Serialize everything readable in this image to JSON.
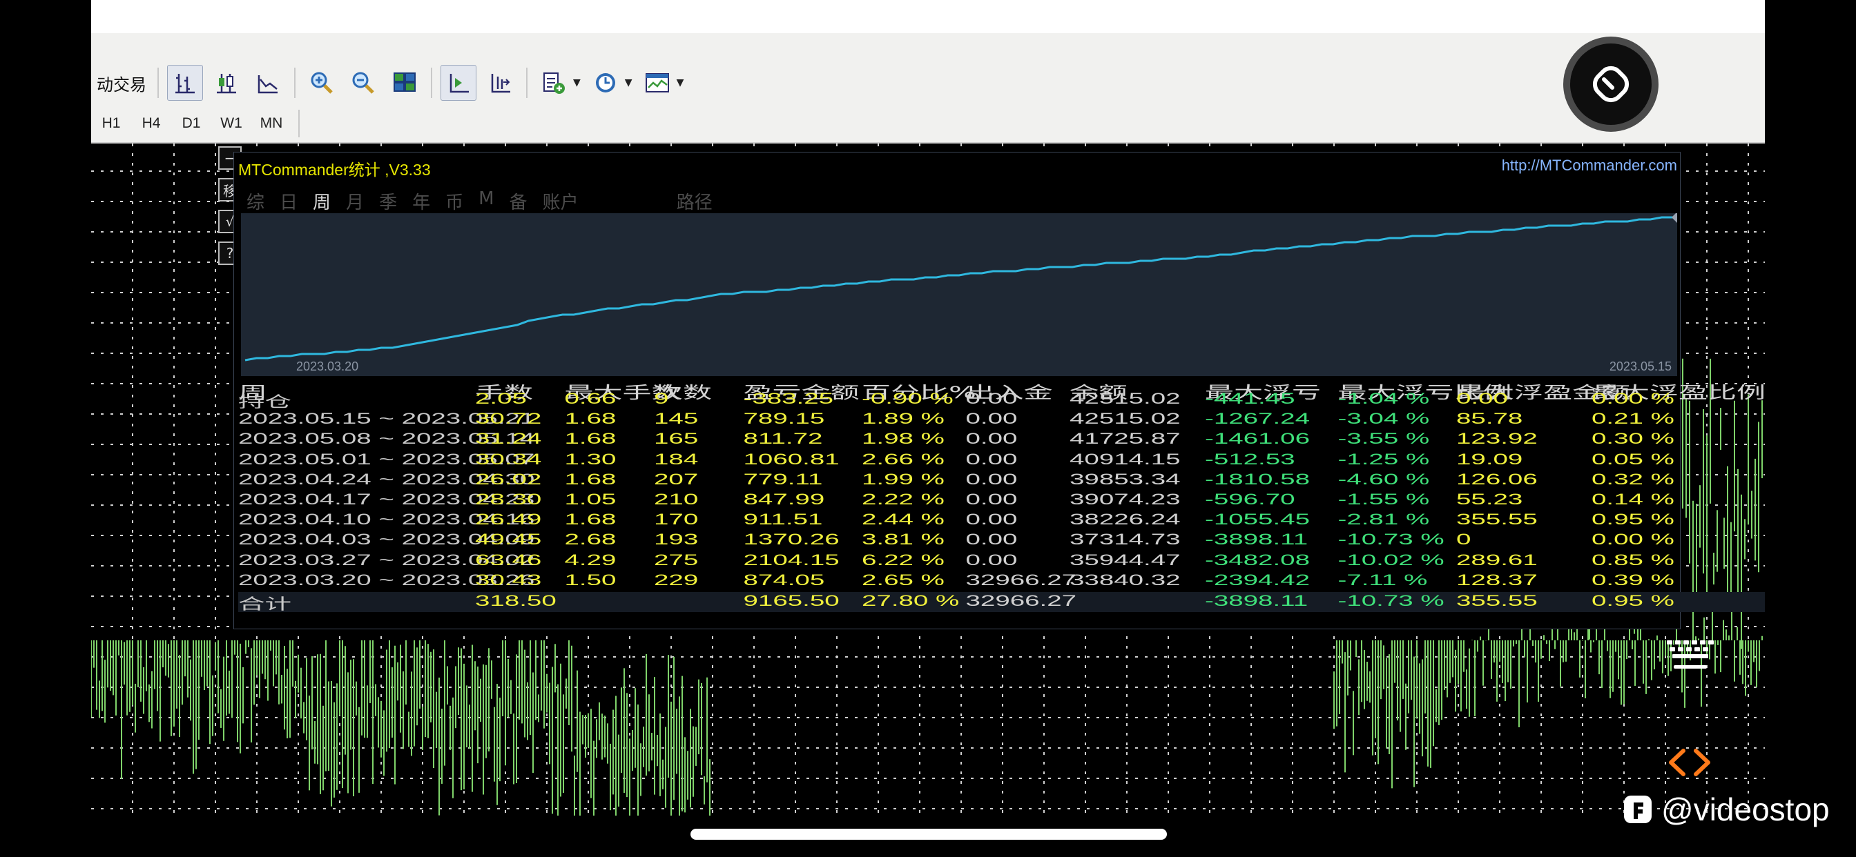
{
  "toolbar": {
    "auto_trade_label": "动交易",
    "timeframes": [
      "H1",
      "H4",
      "D1",
      "W1",
      "MN"
    ]
  },
  "panel": {
    "title": "MTCommander统计 ,V3.33",
    "url": "http://MTCommander.com",
    "side_buttons": [
      "−",
      "移",
      "√",
      "?"
    ],
    "tabs": [
      "综",
      "日",
      "周",
      "月",
      "季",
      "年",
      "币",
      "M",
      "备",
      "账户"
    ],
    "active_tab": "周",
    "path_label": "路径",
    "curve": {
      "start_date_label": "2023.03.20",
      "end_date_label": "2023.05.15",
      "line_color": "#2fb8df"
    },
    "columns": [
      "周",
      "手数",
      "最大手数",
      "次数",
      "盈亏金额",
      "百分比%",
      "出入金",
      "余额",
      "最大浮亏",
      "最大浮亏比例",
      "最大浮盈金额",
      "最大浮盈比例"
    ],
    "rows": [
      [
        "持仓",
        "2.05",
        "0.66",
        "9",
        "-383.25",
        "-0.90 %",
        "0.00",
        "42515.02",
        "-441.45",
        "-1.04 %",
        "0.00",
        "0.00 %"
      ],
      [
        "2023.05.15 ~ 2023.05.21",
        "30.72",
        "1.68",
        "145",
        "789.15",
        "1.89 %",
        "0.00",
        "42515.02",
        "-1267.24",
        "-3.04 %",
        "85.78",
        "0.21 %"
      ],
      [
        "2023.05.08 ~ 2023.05.14",
        "31.24",
        "1.68",
        "165",
        "811.72",
        "1.98 %",
        "0.00",
        "41725.87",
        "-1461.06",
        "-3.55 %",
        "123.92",
        "0.30 %"
      ],
      [
        "2023.05.01 ~ 2023.05.07",
        "30.34",
        "1.30",
        "184",
        "1060.81",
        "2.66 %",
        "0.00",
        "40914.15",
        "-512.53",
        "-1.25 %",
        "19.09",
        "0.05 %"
      ],
      [
        "2023.04.24 ~ 2023.04.30",
        "26.02",
        "1.68",
        "207",
        "779.11",
        "1.99 %",
        "0.00",
        "39853.34",
        "-1810.58",
        "-4.60 %",
        "126.06",
        "0.32 %"
      ],
      [
        "2023.04.17 ~ 2023.04.23",
        "28.30",
        "1.05",
        "210",
        "847.99",
        "2.22 %",
        "0.00",
        "39074.23",
        "-596.70",
        "-1.55 %",
        "55.23",
        "0.14 %"
      ],
      [
        "2023.04.10 ~ 2023.04.16",
        "26.49",
        "1.68",
        "170",
        "911.51",
        "2.44 %",
        "0.00",
        "38226.24",
        "-1055.45",
        "-2.81 %",
        "355.55",
        "0.95 %"
      ],
      [
        "2023.04.03 ~ 2023.04.09",
        "49.45",
        "2.68",
        "193",
        "1370.26",
        "3.81 %",
        "0.00",
        "37314.73",
        "-3898.11",
        "-10.73 %",
        "0",
        "0.00 %"
      ],
      [
        "2023.03.27 ~ 2023.04.02",
        "63.46",
        "4.29",
        "275",
        "2104.15",
        "6.22 %",
        "0.00",
        "35944.47",
        "-3482.08",
        "-10.02 %",
        "289.61",
        "0.85 %"
      ],
      [
        "2023.03.20 ~ 2023.03.26",
        "30.43",
        "1.50",
        "229",
        "874.05",
        "2.65 %",
        "32966.27",
        "33840.32",
        "-2394.42",
        "-7.11 %",
        "128.37",
        "0.39 %"
      ]
    ],
    "total": [
      "合计",
      "318.50",
      "",
      "",
      "9165.50",
      "27.80 %",
      "32966.27",
      "",
      "-3898.11",
      "-10.73 %",
      "355.55",
      "0.95 %"
    ]
  },
  "overlays": {
    "watermark": "@videostop"
  },
  "icons": {
    "record": "cursor-stop-icon",
    "keyboard": "keyboard-icon",
    "code": "code-brackets-icon"
  }
}
